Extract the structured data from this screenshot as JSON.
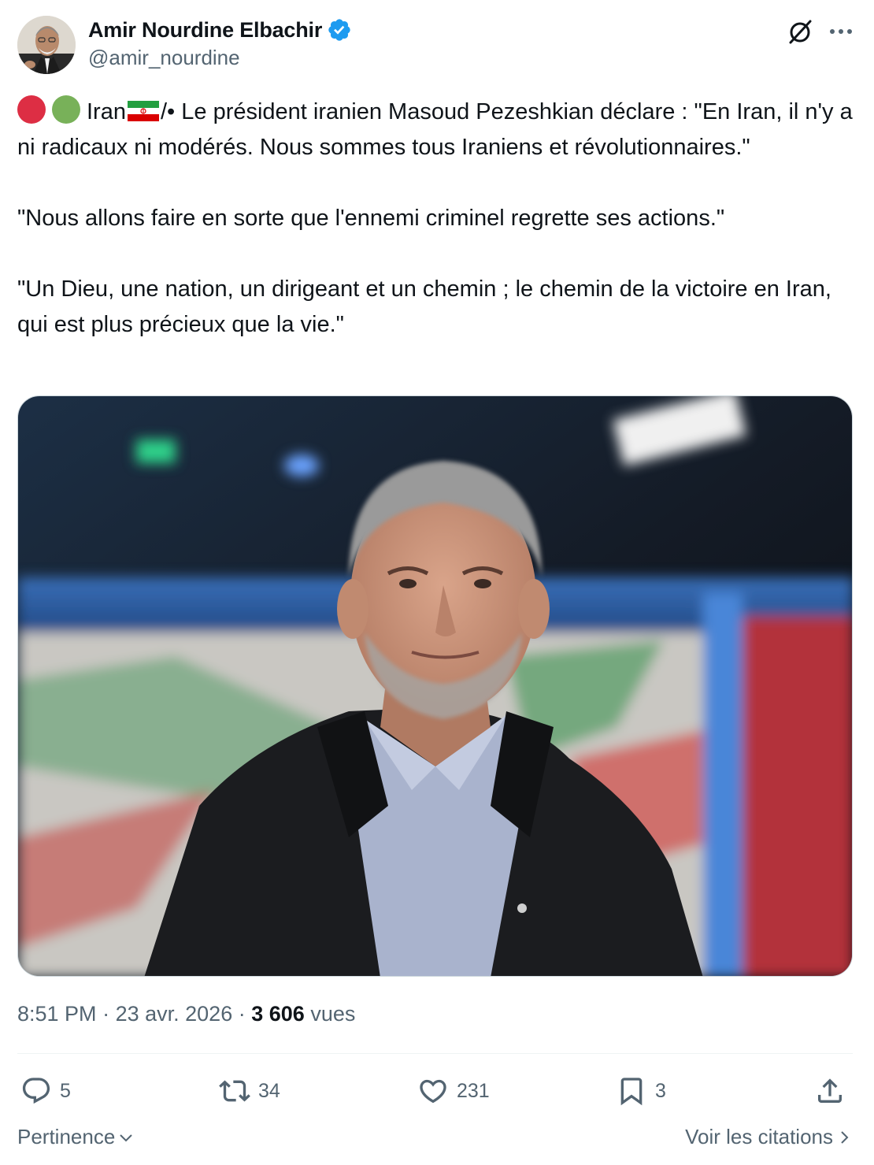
{
  "author": {
    "display_name": "Amir Nourdine Elbachir",
    "handle": "@amir_nourdine",
    "verified": true
  },
  "icons": {
    "verified": "verified-badge-icon",
    "grok": "grok-icon",
    "more": "more-options-icon",
    "reply": "reply-icon",
    "repost": "repost-icon",
    "like": "like-icon",
    "bookmark": "bookmark-icon",
    "share": "share-icon"
  },
  "colors": {
    "red_dot": "#dd2e44",
    "green_dot": "#78b159",
    "verified": "#1d9bf0",
    "secondary_text": "#536471"
  },
  "tweet": {
    "line1_word": "Iran",
    "line1_rest": "/• Le président iranien Masoud Pezeshkian déclare : \"En Iran, il n'y a ni radicaux ni modérés. Nous sommes tous Iraniens et révolutionnaires.\"",
    "paragraph2": "\"Nous allons faire en sorte que l'ennemi criminel regrette ses actions.\"",
    "paragraph3": "\"Un Dieu, une nation, un dirigeant et un chemin ; le chemin de la victoire en Iran, qui est plus précieux que la vie.\""
  },
  "meta": {
    "time": "8:51 PM",
    "separator": "·",
    "date": "23 avr. 2026",
    "views_count": "3 606",
    "views_label": "vues"
  },
  "actions": {
    "replies": "5",
    "reposts": "34",
    "likes": "231",
    "bookmarks": "3"
  },
  "footer": {
    "sort_label": "Pertinence",
    "quotes_label": "Voir les citations"
  }
}
